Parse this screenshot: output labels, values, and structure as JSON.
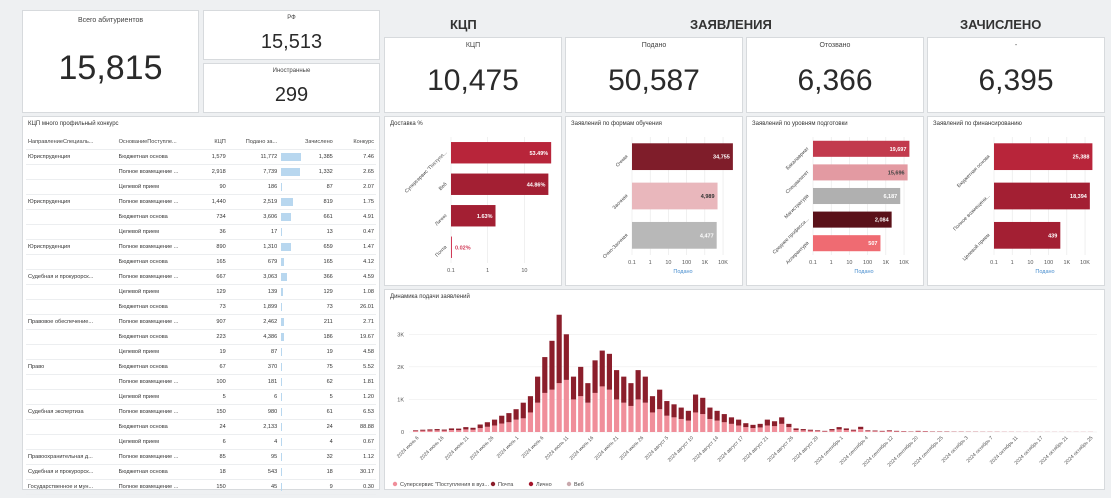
{
  "kpis": {
    "total": {
      "label": "Всего абитуриентов",
      "value": "15,815"
    },
    "rf": {
      "label": "РФ",
      "value": "15,513"
    },
    "foreign": {
      "label": "Иностранные",
      "value": "299"
    },
    "kcp": {
      "label": "КЦП",
      "value": "10,475"
    },
    "submitted": {
      "label": "Подано",
      "value": "50,587"
    },
    "withdrawn": {
      "label": "Отозвано",
      "value": "6,366"
    },
    "enrolled": {
      "label": "-",
      "value": "6,395"
    }
  },
  "sections": {
    "kcp": "КЦП",
    "applications": "ЗАЯВЛЕНИЯ",
    "enrolled": "ЗАЧИСЛЕНО"
  },
  "table": {
    "title": "КЦП много профильный конкурс",
    "headers": [
      "НаправлениеСпециаль...",
      "ОснованиеПоступле...",
      "КЦП",
      "Подано за...",
      "Зачислено",
      "Конкурс"
    ],
    "rows": [
      [
        "Юриспруденция",
        "Бюджетная основа",
        "1,579",
        "11,772",
        "1,385",
        "7.46"
      ],
      [
        "",
        "Полное возмещение ...",
        "2,918",
        "7,739",
        "1,332",
        "2.65"
      ],
      [
        "",
        "Целевой прием",
        "90",
        "186",
        "87",
        "2.07"
      ],
      [
        "Юриспруденция",
        "Полное возмещение ...",
        "1,440",
        "2,519",
        "819",
        "1.75"
      ],
      [
        "",
        "Бюджетная основа",
        "734",
        "3,606",
        "661",
        "4.91"
      ],
      [
        "",
        "Целевой прием",
        "36",
        "17",
        "13",
        "0.47"
      ],
      [
        "Юриспруденция",
        "Полное возмещение ...",
        "890",
        "1,310",
        "659",
        "1.47"
      ],
      [
        "",
        "Бюджетная основа",
        "165",
        "679",
        "165",
        "4.12"
      ],
      [
        "Судебная и прокурорск...",
        "Полное возмещение ...",
        "667",
        "3,063",
        "366",
        "4.59"
      ],
      [
        "",
        "Целевой прием",
        "129",
        "139",
        "129",
        "1.08"
      ],
      [
        "",
        "Бюджетная основа",
        "73",
        "1,899",
        "73",
        "26.01"
      ],
      [
        "Правовое обеспечение...",
        "Полное возмещение ...",
        "907",
        "2,462",
        "211",
        "2.71"
      ],
      [
        "",
        "Бюджетная основа",
        "223",
        "4,386",
        "186",
        "19.67"
      ],
      [
        "",
        "Целевой прием",
        "19",
        "87",
        "19",
        "4.58"
      ],
      [
        "Право",
        "Бюджетная основа",
        "67",
        "370",
        "75",
        "5.52"
      ],
      [
        "",
        "Полное возмещение ...",
        "100",
        "181",
        "62",
        "1.81"
      ],
      [
        "",
        "Целевой прием",
        "5",
        "6",
        "5",
        "1.20"
      ],
      [
        "Судебная экспертиза",
        "Полное возмещение ...",
        "150",
        "980",
        "61",
        "6.53"
      ],
      [
        "",
        "Бюджетная основа",
        "24",
        "2,133",
        "24",
        "88.88"
      ],
      [
        "",
        "Целевой прием",
        "6",
        "4",
        "4",
        "0.67"
      ],
      [
        "Правоохранительная д...",
        "Полное возмещение ...",
        "85",
        "95",
        "32",
        "1.12"
      ],
      [
        "Судебная и прокурорск...",
        "Бюджетная основа",
        "18",
        "543",
        "18",
        "30.17"
      ],
      [
        "Государственное и мун...",
        "Полное возмещение ...",
        "150",
        "45",
        "9",
        "0.30"
      ]
    ],
    "enrolled_max": 1385
  },
  "chart_data": [
    {
      "type": "bar",
      "orientation": "horizontal",
      "scale": "log",
      "title": "Доставка %",
      "categories": [
        "Суперсервис \"Поступл...",
        "Веб",
        "Лично",
        "Почта"
      ],
      "values": [
        53.49,
        44.86,
        1.63,
        0.02
      ],
      "labels": [
        "53.49%",
        "44.86%",
        "1.63%",
        "0.02%"
      ],
      "ticks": [
        "0.1",
        "1",
        "10"
      ],
      "xlim": [
        0.1,
        60
      ]
    },
    {
      "type": "bar",
      "orientation": "horizontal",
      "scale": "log",
      "title": "Заявлений по формам обучения",
      "xlabel": "Подано",
      "categories": [
        "Очная",
        "Заочная",
        "Очно-Заочная"
      ],
      "values": [
        34755,
        4989,
        4477
      ],
      "labels": [
        "34,755",
        "4,989",
        "4,477"
      ],
      "ticks": [
        "0.1",
        "1",
        "10",
        "100",
        "1K",
        "10K"
      ],
      "xlim": [
        0.1,
        40000
      ]
    },
    {
      "type": "bar",
      "orientation": "horizontal",
      "scale": "log",
      "title": "Заявлений по уровням подготовки",
      "xlabel": "Подано",
      "categories": [
        "Бакалавриат",
        "Специалитет",
        "Магистратура",
        "Среднее професси...",
        "Аспирантура"
      ],
      "values": [
        19697,
        15696,
        6187,
        2084,
        507
      ],
      "labels": [
        "19,697",
        "15,696",
        "6,187",
        "2,084",
        "507"
      ],
      "ticks": [
        "0.1",
        "1",
        "10",
        "100",
        "1K",
        "10K"
      ],
      "xlim": [
        0.1,
        40000
      ]
    },
    {
      "type": "bar",
      "orientation": "horizontal",
      "scale": "log",
      "title": "Заявлений по финансированию",
      "xlabel": "Подано",
      "categories": [
        "Бюджетная основа",
        "Полное возмещени...",
        "Целевой прием"
      ],
      "values": [
        25388,
        18394,
        439
      ],
      "labels": [
        "25,388",
        "18,394",
        "439"
      ],
      "ticks": [
        "0.1",
        "1",
        "10",
        "100",
        "1K",
        "10K"
      ],
      "xlim": [
        0.1,
        40000
      ]
    },
    {
      "type": "bar",
      "stacked": true,
      "title": "Динамика подачи заявлений",
      "yticks": [
        "0",
        "1K",
        "2K",
        "3K"
      ],
      "ylim": [
        0,
        3500
      ],
      "xticks": [
        "2024 июнь 6",
        "2024 июнь 16",
        "2024 июнь 21",
        "2024 июнь 26",
        "2024 июль 1",
        "2024 июль 6",
        "2024 июль 11",
        "2024 июль 16",
        "2024 июль 21",
        "2024 июль 26",
        "2024 август 5",
        "2024 август 10",
        "2024 август 14",
        "2024 август 17",
        "2024 август 21",
        "2024 август 26",
        "2024 август 29",
        "2024 сентябрь 1",
        "2024 сентябрь 4",
        "2024 сентябрь 12",
        "2024 сентябрь 20",
        "2024 сентябрь 25",
        "2024 октябрь 3",
        "2024 октябрь 7",
        "2024 октябрь 11",
        "2024 октябрь 17",
        "2024 октябрь 21",
        "2024 октябрь 25"
      ],
      "series": [
        {
          "name": "Суперсервис \"Поступления в вуз...",
          "color": "#f08e9a",
          "values": [
            30,
            40,
            45,
            50,
            40,
            60,
            55,
            80,
            70,
            120,
            160,
            200,
            260,
            300,
            380,
            420,
            600,
            900,
            1200,
            1300,
            1500,
            1600,
            1000,
            1100,
            900,
            1200,
            1400,
            1300,
            1000,
            900,
            800,
            1000,
            900,
            600,
            700,
            500,
            450,
            400,
            350,
            600,
            550,
            400,
            350,
            300,
            250,
            200,
            150,
            120,
            140,
            200,
            180,
            250,
            150,
            60,
            50,
            40,
            30,
            20,
            50,
            80,
            60,
            40,
            90,
            30,
            25,
            20,
            30,
            20,
            15,
            10,
            20,
            15,
            10,
            10,
            10,
            8,
            8,
            6,
            6,
            5,
            5,
            5,
            4,
            4,
            3,
            3,
            3,
            2,
            2,
            2,
            2,
            2,
            2,
            2,
            2
          ]
        },
        {
          "name": "Почта",
          "color": "#8b1e2b",
          "values": [
            20,
            30,
            35,
            40,
            35,
            50,
            50,
            70,
            60,
            110,
            140,
            180,
            240,
            280,
            320,
            480,
            500,
            800,
            1100,
            1500,
            2100,
            1400,
            700,
            900,
            600,
            1000,
            1100,
            1100,
            900,
            800,
            700,
            900,
            800,
            500,
            600,
            450,
            400,
            350,
            300,
            550,
            500,
            350,
            300,
            250,
            200,
            180,
            120,
            100,
            110,
            180,
            150,
            200,
            100,
            50,
            40,
            30,
            20,
            15,
            40,
            70,
            50,
            30,
            70,
            20,
            20,
            15,
            20,
            15,
            10,
            8,
            15,
            10,
            8,
            8,
            8,
            6,
            6,
            5,
            5,
            4,
            4,
            4,
            3,
            3,
            2,
            2,
            2,
            2,
            2,
            2,
            2,
            2,
            2,
            2,
            2
          ]
        },
        {
          "name": "Лично",
          "color": "#a4142a",
          "values": []
        },
        {
          "name": "Веб",
          "color": "#c9a9ad",
          "values": []
        }
      ]
    }
  ]
}
